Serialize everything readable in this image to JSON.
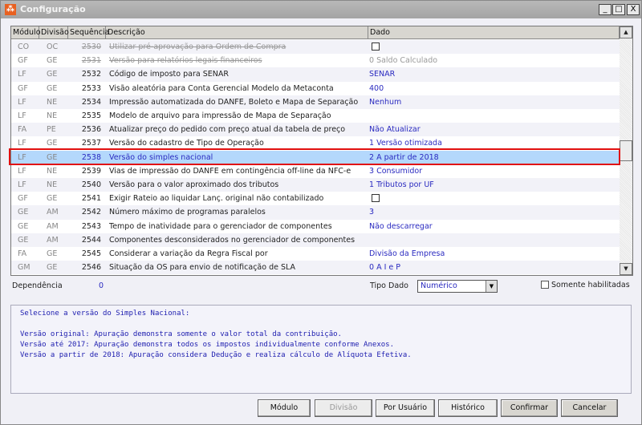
{
  "window": {
    "title": "Configuração",
    "minimize": "_",
    "maximize": "□",
    "close": "X"
  },
  "table": {
    "headers": [
      "Módulo",
      "Divisão",
      "Sequência",
      "Descrição",
      "Dado"
    ],
    "rows": [
      {
        "modulo": "CO",
        "divisao": "OC",
        "seq": "2530",
        "desc": "Utilizar pré-aprovação para Ordem de Compra",
        "dado": "",
        "checkbox": true,
        "disabled": true
      },
      {
        "modulo": "GF",
        "divisao": "GE",
        "seq": "2531",
        "desc": "Versão para relatórios legais financeiros",
        "dado": "0 Saldo Calculado",
        "disabled": true
      },
      {
        "modulo": "LF",
        "divisao": "GE",
        "seq": "2532",
        "desc": "Código de imposto para SENAR",
        "dado": "SENAR"
      },
      {
        "modulo": "GF",
        "divisao": "GE",
        "seq": "2533",
        "desc": "Visão aleatória para Conta Gerencial Modelo da Metaconta",
        "dado": "400"
      },
      {
        "modulo": "LF",
        "divisao": "NE",
        "seq": "2534",
        "desc": "Impressão automatizada do DANFE, Boleto e Mapa de Separação",
        "dado": " Nenhum"
      },
      {
        "modulo": "LF",
        "divisao": "NE",
        "seq": "2535",
        "desc": "Modelo de arquivo para impressão de Mapa de Separação",
        "dado": ""
      },
      {
        "modulo": "FA",
        "divisao": "PE",
        "seq": "2536",
        "desc": "Atualizar preço do pedido com preço atual da tabela de preço",
        "dado": "Não Atualizar"
      },
      {
        "modulo": "LF",
        "divisao": "GE",
        "seq": "2537",
        "desc": "Versão do cadastro de Tipo de Operação",
        "dado": "1 Versão otimizada"
      },
      {
        "modulo": "LF",
        "divisao": "GE",
        "seq": "2538",
        "desc": "Versão do simples nacional",
        "dado": "2 A partir de 2018",
        "selected": true
      },
      {
        "modulo": "LF",
        "divisao": "NE",
        "seq": "2539",
        "desc": "Vias de impressão do DANFE em contingência off-line da NFC-e",
        "dado": "3 Consumidor"
      },
      {
        "modulo": "LF",
        "divisao": "NE",
        "seq": "2540",
        "desc": "Versão para o valor aproximado dos tributos",
        "dado": "1 Tributos por UF"
      },
      {
        "modulo": "GF",
        "divisao": "GE",
        "seq": "2541",
        "desc": "Exigir Rateio ao liquidar Lanç. original não contabilizado",
        "dado": "",
        "checkbox": true
      },
      {
        "modulo": "GE",
        "divisao": "AM",
        "seq": "2542",
        "desc": "Número máximo de programas paralelos",
        "dado": "3"
      },
      {
        "modulo": "GE",
        "divisao": "AM",
        "seq": "2543",
        "desc": "Tempo de inatividade para o gerenciador de componentes",
        "dado": "Não descarregar"
      },
      {
        "modulo": "GE",
        "divisao": "AM",
        "seq": "2544",
        "desc": "Componentes desconsiderados no gerenciador de componentes",
        "dado": ""
      },
      {
        "modulo": "FA",
        "divisao": "GE",
        "seq": "2545",
        "desc": "Considerar a variação da Regra Fiscal por",
        "dado": "Divisão da Empresa"
      },
      {
        "modulo": "GM",
        "divisao": "GE",
        "seq": "2546",
        "desc": "Situação da OS para envio de notificação de SLA",
        "dado": "0 A I e P"
      }
    ]
  },
  "footer": {
    "dependencia_label": "Dependência",
    "dependencia_value": "0",
    "tipo_dado_label": "Tipo Dado",
    "tipo_dado_value": "Numérico",
    "somente_label": "Somente habilitadas"
  },
  "description": "Selecione a versão do Simples Nacional:\n\nVersão original: Apuração demonstra somente o valor total da contribuição.\nVersão até 2017: Apuração demonstra todos os impostos individualmente conforme Anexos.\nVersão a partir de 2018: Apuração considera Dedução e realiza cálculo de Alíquota Efetiva.",
  "buttons": {
    "modulo": "Módulo",
    "divisao": "Divisão",
    "por_usuario": "Por Usuário",
    "historico": "Histórico",
    "confirmar": "Confirmar",
    "cancelar": "Cancelar"
  }
}
